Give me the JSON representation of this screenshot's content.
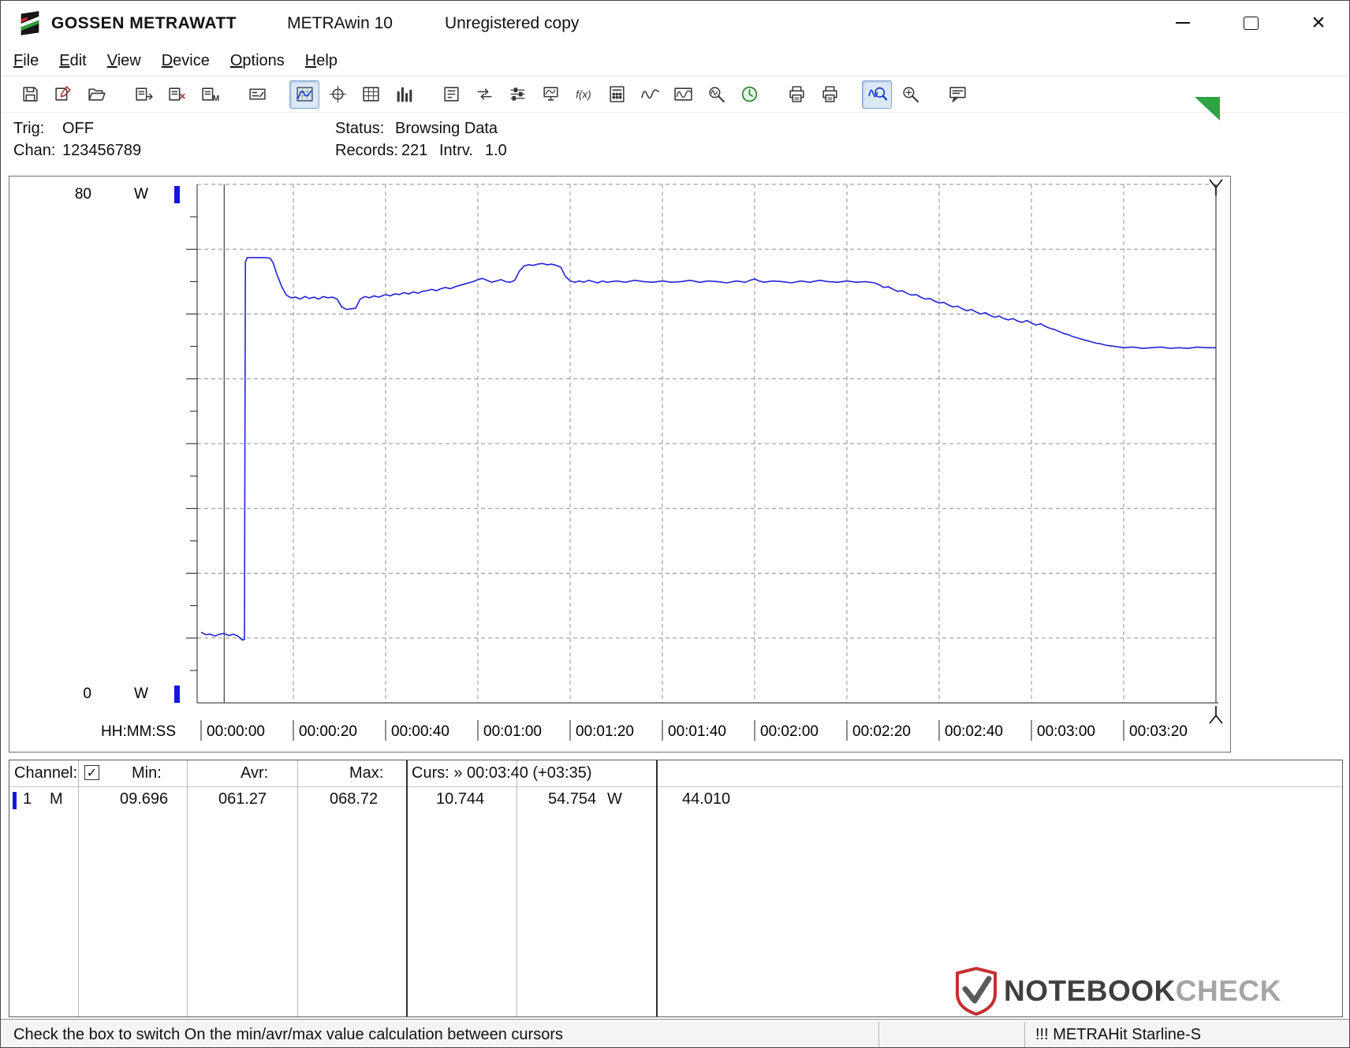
{
  "window": {
    "brand": "GOSSEN METRAWATT",
    "app": "METRAwin 10",
    "license": "Unregistered copy"
  },
  "menu": {
    "items": [
      {
        "label": "File"
      },
      {
        "label": "Edit"
      },
      {
        "label": "View"
      },
      {
        "label": "Device"
      },
      {
        "label": "Options"
      },
      {
        "label": "Help"
      }
    ]
  },
  "toolbar": {
    "items": [
      {
        "name": "save-icon",
        "shape": "floppy"
      },
      {
        "name": "save-as-icon",
        "shape": "floppy-pen"
      },
      {
        "name": "open-icon",
        "shape": "folder"
      },
      {
        "type": "sep"
      },
      {
        "name": "export-data-icon",
        "shape": "card-out"
      },
      {
        "name": "clear-data-icon",
        "shape": "card-x"
      },
      {
        "name": "memory-read-icon",
        "shape": "card-m"
      },
      {
        "type": "sep"
      },
      {
        "name": "multimeter-display-icon",
        "shape": "meter"
      },
      {
        "type": "sep"
      },
      {
        "name": "chart-view-icon",
        "shape": "grid-wave",
        "pressed": true
      },
      {
        "name": "scope-view-icon",
        "shape": "crosshair"
      },
      {
        "name": "table-view-icon",
        "shape": "table"
      },
      {
        "name": "bar-graph-view-icon",
        "shape": "bars"
      },
      {
        "type": "sep"
      },
      {
        "name": "trigger-settings-icon",
        "shape": "card-cfg"
      },
      {
        "name": "data-transfer-icon",
        "shape": "transfer"
      },
      {
        "name": "logger-settings-icon",
        "shape": "sliders"
      },
      {
        "name": "online-display-icon",
        "shape": "monitor"
      },
      {
        "name": "formula-icon",
        "shape": "fx"
      },
      {
        "name": "device-panel-icon",
        "shape": "keypad"
      },
      {
        "name": "signal-icon",
        "shape": "wave"
      },
      {
        "name": "envelope-icon",
        "shape": "wave-box"
      },
      {
        "name": "data-zoom-icon",
        "shape": "lens-wave"
      },
      {
        "name": "timer-icon",
        "shape": "clock"
      },
      {
        "type": "sep"
      },
      {
        "name": "print-preview-icon",
        "shape": "printer"
      },
      {
        "name": "print-icon",
        "shape": "printer"
      },
      {
        "type": "sep"
      },
      {
        "name": "zoom-signal-icon",
        "shape": "zoom-wave",
        "pressed": true
      },
      {
        "name": "zoom-reset-icon",
        "shape": "lens"
      },
      {
        "type": "sep"
      },
      {
        "name": "comment-icon",
        "shape": "note"
      }
    ]
  },
  "status_panel": {
    "trig_label": "Trig:",
    "trig_value": "OFF",
    "chan_label": "Chan:",
    "chan_value": "123456789",
    "status_label": "Status:",
    "status_value": "Browsing Data",
    "records_label": "Records:",
    "records_value": "221",
    "interval_label": "Intrv.",
    "interval_value": "1.0"
  },
  "chart_data": {
    "type": "line",
    "xlabel": "HH:MM:SS",
    "ylabel": "W",
    "ylim": [
      0,
      80
    ],
    "x_range_seconds": [
      0,
      220
    ],
    "grid": true,
    "y_axis": {
      "top_label": "80",
      "bottom_label": "0",
      "unit": "W"
    },
    "x_ticks": [
      "00:00:00",
      "00:00:20",
      "00:00:40",
      "00:01:00",
      "00:01:20",
      "00:01:40",
      "00:02:00",
      "00:02:20",
      "00:02:40",
      "00:03:00",
      "00:03:20"
    ],
    "x_tick_seconds": [
      0,
      20,
      40,
      60,
      80,
      100,
      120,
      140,
      160,
      180,
      200
    ],
    "cursors": {
      "cursor1_s": 5,
      "cursor2_s": 220,
      "readout": "Curs: » 00:03:40 (+03:35)"
    },
    "series": [
      {
        "name": "channel-1-power-w",
        "color": "#2222d8",
        "points": [
          [
            0,
            10.9
          ],
          [
            1,
            10.5
          ],
          [
            2,
            10.6
          ],
          [
            3,
            10.3
          ],
          [
            4,
            10.6
          ],
          [
            5,
            10.7
          ],
          [
            6,
            10.4
          ],
          [
            7,
            10.6
          ],
          [
            8,
            10.3
          ],
          [
            8.6,
            9.9
          ],
          [
            9,
            9.7
          ],
          [
            9.4,
            9.8
          ],
          [
            9.6,
            68
          ],
          [
            10,
            68.7
          ],
          [
            12,
            68.7
          ],
          [
            14,
            68.7
          ],
          [
            15,
            68.6
          ],
          [
            15.6,
            67.9
          ],
          [
            16.5,
            66
          ],
          [
            17.5,
            64.2
          ],
          [
            18.5,
            62.9
          ],
          [
            19.5,
            62.5
          ],
          [
            20.5,
            62.6
          ],
          [
            21.5,
            62.3
          ],
          [
            22.5,
            62.7
          ],
          [
            23.5,
            62.4
          ],
          [
            24.5,
            62.6
          ],
          [
            25.5,
            62.3
          ],
          [
            26.5,
            62.7
          ],
          [
            27.5,
            62.5
          ],
          [
            28.5,
            62.6
          ],
          [
            29.5,
            62.3
          ],
          [
            30.5,
            61.1
          ],
          [
            31.5,
            60.7
          ],
          [
            32.5,
            60.8
          ],
          [
            33.5,
            60.9
          ],
          [
            34.5,
            62.3
          ],
          [
            35.5,
            62.7
          ],
          [
            36.5,
            62.5
          ],
          [
            37.5,
            62.8
          ],
          [
            38.5,
            62.6
          ],
          [
            40,
            63
          ],
          [
            41,
            62.8
          ],
          [
            42,
            63.1
          ],
          [
            43,
            63
          ],
          [
            44,
            63.3
          ],
          [
            45,
            63.1
          ],
          [
            46,
            63.4
          ],
          [
            47,
            63.2
          ],
          [
            48,
            63.5
          ],
          [
            49,
            63.6
          ],
          [
            50,
            63.8
          ],
          [
            51,
            63.6
          ],
          [
            52,
            63.9
          ],
          [
            53,
            64.1
          ],
          [
            54,
            63.9
          ],
          [
            55,
            64.2
          ],
          [
            56,
            64.4
          ],
          [
            57,
            64.6
          ],
          [
            58,
            64.8
          ],
          [
            59,
            65
          ],
          [
            60,
            65.3
          ],
          [
            61,
            65.5
          ],
          [
            62,
            65.2
          ],
          [
            63,
            64.9
          ],
          [
            64,
            65.1
          ],
          [
            65,
            65.3
          ],
          [
            66,
            65
          ],
          [
            67,
            64.9
          ],
          [
            68,
            65.2
          ],
          [
            69,
            66.6
          ],
          [
            70,
            67.4
          ],
          [
            71,
            67.6
          ],
          [
            72,
            67.5
          ],
          [
            73,
            67.7
          ],
          [
            74,
            67.8
          ],
          [
            75,
            67.6
          ],
          [
            76,
            67.7
          ],
          [
            77,
            67.5
          ],
          [
            78,
            67.2
          ],
          [
            79,
            65.8
          ],
          [
            80,
            65.1
          ],
          [
            81,
            64.9
          ],
          [
            82,
            65.1
          ],
          [
            83,
            64.9
          ],
          [
            84,
            65.2
          ],
          [
            85,
            65
          ],
          [
            86,
            64.8
          ],
          [
            87,
            65.1
          ],
          [
            88,
            64.9
          ],
          [
            90,
            65.1
          ],
          [
            92,
            64.9
          ],
          [
            94,
            65.2
          ],
          [
            96,
            65
          ],
          [
            98,
            64.9
          ],
          [
            100,
            65.1
          ],
          [
            102,
            64.9
          ],
          [
            104,
            65
          ],
          [
            106,
            65.2
          ],
          [
            108,
            64.9
          ],
          [
            110,
            65.1
          ],
          [
            112,
            65
          ],
          [
            114,
            64.8
          ],
          [
            116,
            65.1
          ],
          [
            118,
            64.9
          ],
          [
            119,
            65.2
          ],
          [
            120,
            65.4
          ],
          [
            121,
            65.1
          ],
          [
            122,
            64.9
          ],
          [
            124,
            65.1
          ],
          [
            126,
            65
          ],
          [
            128,
            64.8
          ],
          [
            130,
            65.1
          ],
          [
            132,
            64.9
          ],
          [
            134,
            65.2
          ],
          [
            136,
            65
          ],
          [
            138,
            64.9
          ],
          [
            140,
            65.1
          ],
          [
            142,
            64.9
          ],
          [
            144,
            65
          ],
          [
            146,
            64.8
          ],
          [
            147,
            64.5
          ],
          [
            148,
            64.1
          ],
          [
            149,
            64.2
          ],
          [
            150,
            63.8
          ],
          [
            151,
            63.5
          ],
          [
            152,
            63.6
          ],
          [
            153,
            63.2
          ],
          [
            154,
            62.9
          ],
          [
            155,
            63
          ],
          [
            156,
            62.6
          ],
          [
            157,
            62.3
          ],
          [
            158,
            62.4
          ],
          [
            159,
            62
          ],
          [
            160,
            61.7
          ],
          [
            161,
            61.8
          ],
          [
            162,
            61.4
          ],
          [
            163,
            61.1
          ],
          [
            164,
            61.2
          ],
          [
            165,
            60.8
          ],
          [
            166,
            60.5
          ],
          [
            167,
            60.7
          ],
          [
            168,
            60.3
          ],
          [
            169,
            60
          ],
          [
            170,
            60.2
          ],
          [
            171,
            59.8
          ],
          [
            172,
            59.5
          ],
          [
            173,
            59.7
          ],
          [
            174,
            59.3
          ],
          [
            175,
            59.1
          ],
          [
            176,
            59.3
          ],
          [
            177,
            58.9
          ],
          [
            178,
            58.7
          ],
          [
            179,
            59
          ],
          [
            180,
            58.6
          ],
          [
            181,
            58.3
          ],
          [
            182,
            58.5
          ],
          [
            183,
            58.1
          ],
          [
            184,
            57.8
          ],
          [
            185,
            57.6
          ],
          [
            186,
            57.3
          ],
          [
            187,
            57
          ],
          [
            188,
            56.8
          ],
          [
            189,
            56.5
          ],
          [
            190,
            56.3
          ],
          [
            191,
            56.1
          ],
          [
            192,
            55.9
          ],
          [
            193,
            55.7
          ],
          [
            194,
            55.5
          ],
          [
            195,
            55.4
          ],
          [
            196,
            55.2
          ],
          [
            197,
            55.1
          ],
          [
            198,
            55
          ],
          [
            199,
            54.9
          ],
          [
            200,
            54.8
          ],
          [
            202,
            54.9
          ],
          [
            204,
            54.7
          ],
          [
            206,
            54.8
          ],
          [
            208,
            54.9
          ],
          [
            210,
            54.7
          ],
          [
            212,
            54.8
          ],
          [
            214,
            54.7
          ],
          [
            216,
            54.9
          ],
          [
            218,
            54.8
          ],
          [
            220,
            54.8
          ]
        ]
      }
    ]
  },
  "results_table": {
    "header": {
      "channel": "Channel:",
      "checkbox_checked": true,
      "min": "Min:",
      "avr": "Avr:",
      "max": "Max:",
      "cursor": "Curs: » 00:03:40 (+03:35)"
    },
    "row": {
      "channel_num": "1",
      "mode": "M",
      "min": "09.696",
      "avr": "061.27",
      "max": "068.72",
      "cursor1": "10.744",
      "cursor2": "54.754",
      "unit": "W",
      "delta": "44.010"
    }
  },
  "status_bar": {
    "hint": "Check the box to switch On the min/avr/max value calculation between cursors",
    "device": "!!! METRAHit Starline-S"
  },
  "watermark": {
    "text1": "NOTEBOOK",
    "text2": "CHECK"
  },
  "colors": {
    "trace": "#2222d8",
    "channel_marker": "#1515e0",
    "pressed_button_bg": "#dbe8f8",
    "grip_green": "#2ea344"
  }
}
